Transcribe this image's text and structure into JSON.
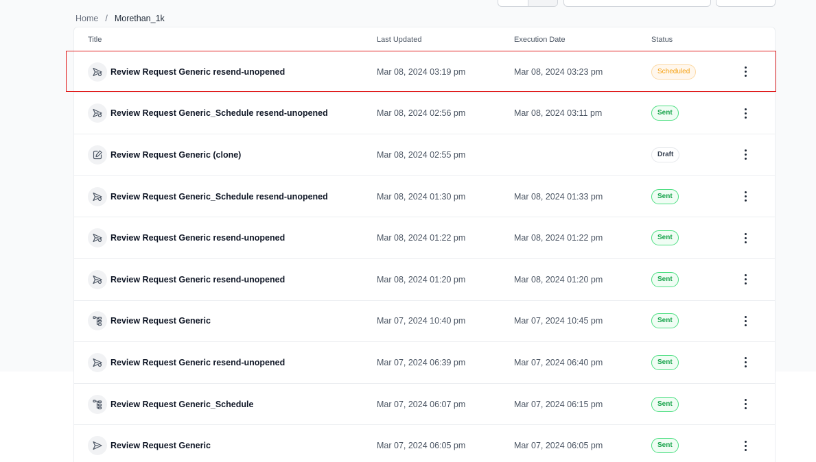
{
  "breadcrumb": {
    "home": "Home",
    "separator": "/",
    "current": "Morethan_1k"
  },
  "table": {
    "headers": {
      "title": "Title",
      "last_updated": "Last Updated",
      "execution_date": "Execution Date",
      "status": "Status"
    },
    "rows": [
      {
        "icon": "send-icon",
        "title": "Review Request Generic resend-unopened",
        "last_updated": "Mar 08, 2024 03:19 pm",
        "execution_date": "Mar 08, 2024 03:23 pm",
        "status": "Scheduled",
        "status_type": "scheduled"
      },
      {
        "icon": "send-icon",
        "title": "Review Request Generic_Schedule resend-unopened",
        "last_updated": "Mar 08, 2024 02:56 pm",
        "execution_date": "Mar 08, 2024 03:11 pm",
        "status": "Sent",
        "status_type": "sent"
      },
      {
        "icon": "edit-icon",
        "title": "Review Request Generic (clone)",
        "last_updated": "Mar 08, 2024 02:55 pm",
        "execution_date": "",
        "status": "Draft",
        "status_type": "draft"
      },
      {
        "icon": "send-icon",
        "title": "Review Request Generic_Schedule resend-unopened",
        "last_updated": "Mar 08, 2024 01:30 pm",
        "execution_date": "Mar 08, 2024 01:33 pm",
        "status": "Sent",
        "status_type": "sent"
      },
      {
        "icon": "send-icon",
        "title": "Review Request Generic resend-unopened",
        "last_updated": "Mar 08, 2024 01:22 pm",
        "execution_date": "Mar 08, 2024 01:22 pm",
        "status": "Sent",
        "status_type": "sent"
      },
      {
        "icon": "send-icon",
        "title": "Review Request Generic resend-unopened",
        "last_updated": "Mar 08, 2024 01:20 pm",
        "execution_date": "Mar 08, 2024 01:20 pm",
        "status": "Sent",
        "status_type": "sent"
      },
      {
        "icon": "workflow-icon",
        "title": "Review Request Generic",
        "last_updated": "Mar 07, 2024 10:40 pm",
        "execution_date": "Mar 07, 2024 10:45 pm",
        "status": "Sent",
        "status_type": "sent"
      },
      {
        "icon": "send-icon",
        "title": "Review Request Generic resend-unopened",
        "last_updated": "Mar 07, 2024 06:39 pm",
        "execution_date": "Mar 07, 2024 06:40 pm",
        "status": "Sent",
        "status_type": "sent"
      },
      {
        "icon": "workflow-icon",
        "title": "Review Request Generic_Schedule",
        "last_updated": "Mar 07, 2024 06:07 pm",
        "execution_date": "Mar 07, 2024 06:15 pm",
        "status": "Sent",
        "status_type": "sent"
      },
      {
        "icon": "paper-plane-icon",
        "title": "Review Request Generic",
        "last_updated": "Mar 07, 2024 06:05 pm",
        "execution_date": "Mar 07, 2024 06:05 pm",
        "status": "Sent",
        "status_type": "sent"
      }
    ]
  },
  "colors": {
    "highlight": "#e11d1d",
    "sent": "#16a34a",
    "scheduled": "#f59e0b",
    "draft": "#374151"
  }
}
